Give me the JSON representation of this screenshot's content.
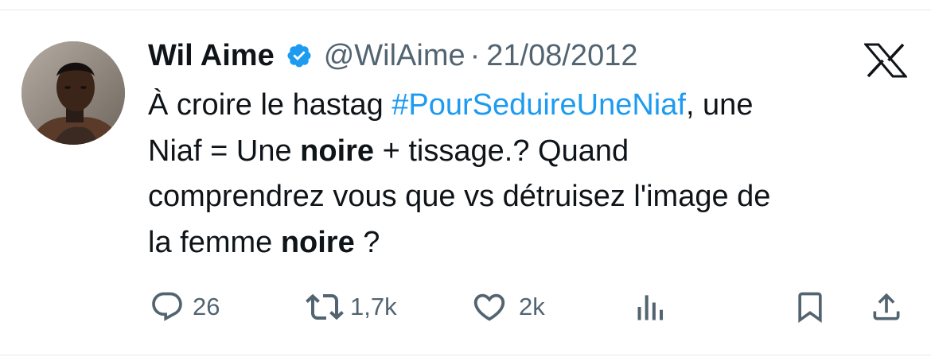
{
  "tweet": {
    "display_name": "Wil Aime",
    "handle": "@WilAime",
    "separator": "·",
    "date": "21/08/2012",
    "text": {
      "l1_a": "À croire le hastag ",
      "hashtag": "#PourSeduireUneNiaf",
      "l1_b": ", une",
      "l2_a": "Niaf = Une ",
      "bold1": "noire",
      "l2_b": " + tissage.? Quand",
      "l3": "comprendrez vous que vs détruisez l'image de",
      "l4_a": "la femme ",
      "bold2": "noire",
      "l4_b": " ?"
    }
  },
  "actions": {
    "replies": "26",
    "retweets": "1,7k",
    "likes": "2k"
  },
  "icons": {
    "verified": "verified-badge-icon",
    "logo": "x-logo-icon",
    "reply": "reply-icon",
    "retweet": "retweet-icon",
    "like": "heart-icon",
    "views": "views-chart-icon",
    "bookmark": "bookmark-icon",
    "share": "share-icon"
  },
  "colors": {
    "accent": "#1d9bf0",
    "text": "#0f1419",
    "secondary": "#536471"
  }
}
